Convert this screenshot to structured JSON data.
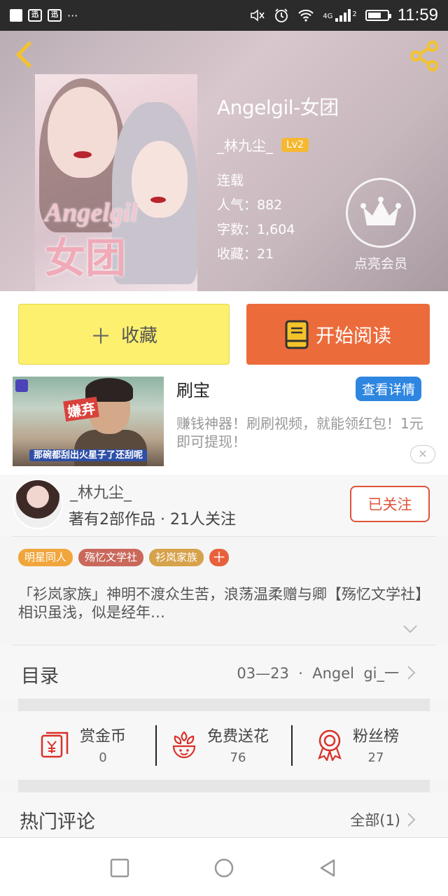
{
  "status_bar": {
    "app1": "迅",
    "app2": "迅",
    "more": "···",
    "network": "4G",
    "sim": "2",
    "time": "11:59"
  },
  "book": {
    "title": "Angelgil-女团",
    "author": "_林九尘_",
    "level": "Lv2",
    "status": "连载",
    "popularity": "人气：882",
    "word_count": "字数：1,604",
    "favorites": "收藏：21",
    "cover_text_en": "Angelgil",
    "cover_text_cn": "女团"
  },
  "vip": {
    "label": "点亮会员"
  },
  "actions": {
    "collect_plus": "＋",
    "collect_label": "收藏",
    "read_label": "开始阅读"
  },
  "ad": {
    "title": "刷宝",
    "detail_button": "查看详情",
    "description": "赚钱神器！刷刷视频，就能领红包！1元即可提现！",
    "thumb_tag": "嫌弃",
    "thumb_caption": "那碗都刮出火星子了还刮呢",
    "close": "✕"
  },
  "author": {
    "name": "_林九尘_",
    "stats": "著有2部作品 · 21人关注",
    "follow_label": "已关注"
  },
  "tags": [
    "明星同人",
    "殇忆文学社",
    "衫岚家族",
    "＋"
  ],
  "intro": "「衫岚家族」神明不渡众生苦，浪荡温柔赠与卿【殇忆文学社】相识虽浅，似是经年…",
  "toc": {
    "label": "目录",
    "latest": "03—23  ·  Angel  gi_一"
  },
  "rewards": [
    {
      "label": "赏金币",
      "count": "0",
      "icon": "coin-envelope-icon"
    },
    {
      "label": "免费送花",
      "count": "76",
      "icon": "flower-icon"
    },
    {
      "label": "粉丝榜",
      "count": "27",
      "icon": "medal-icon"
    }
  ],
  "comments": {
    "label": "热门评论",
    "all": "全部(1)"
  },
  "colors": {
    "collect_bg": "#fdf06f",
    "read_bg": "#ec6b3b",
    "accent_red": "#e0533b",
    "detail_blue": "#2e86e0",
    "level_badge": "#f5b830"
  }
}
